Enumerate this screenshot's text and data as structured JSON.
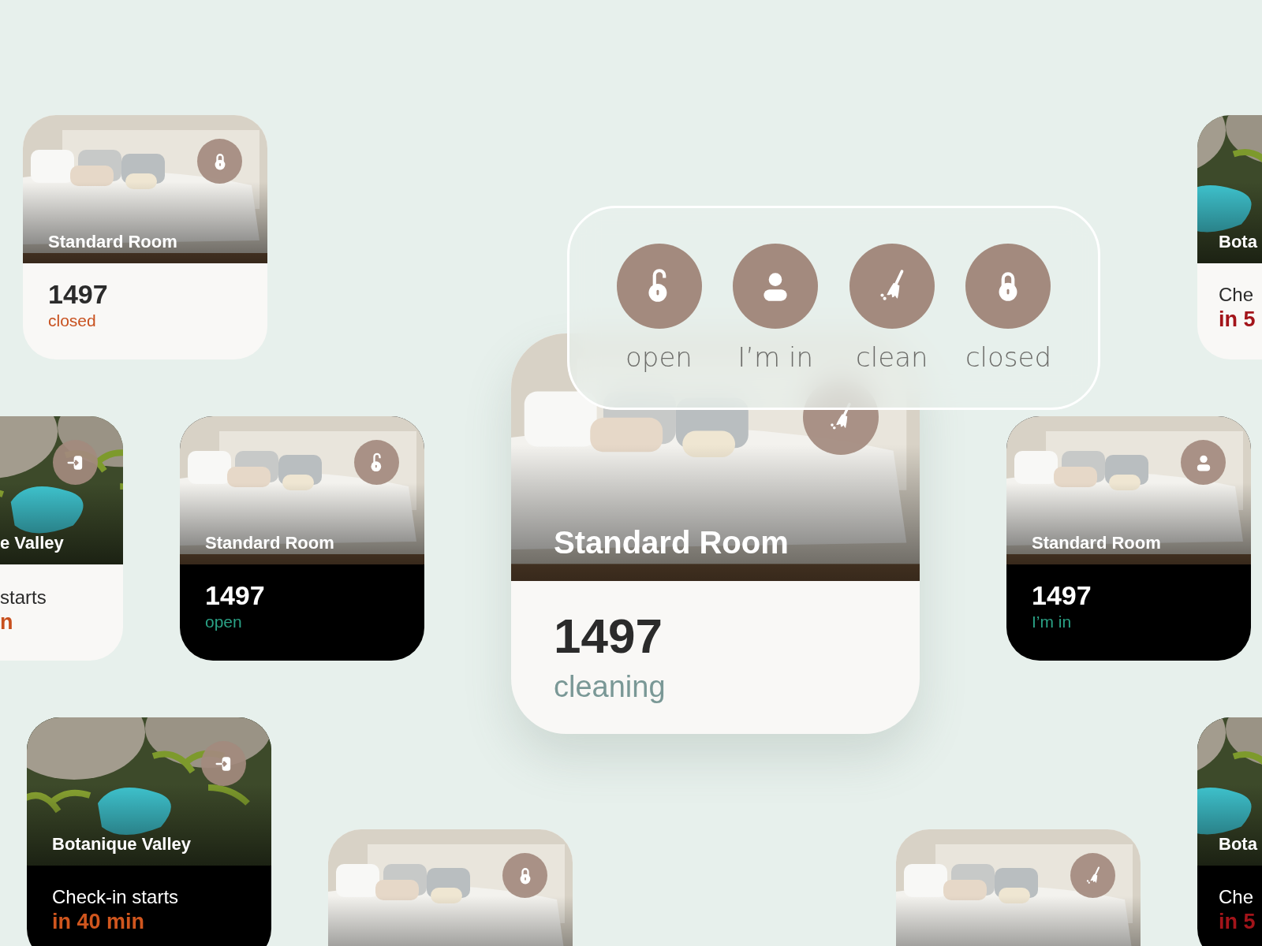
{
  "cards": [
    {
      "kind": "room",
      "title": "Standard Room",
      "line_1": "1497",
      "line_2": "closed",
      "color": "#c8501e"
    },
    {
      "kind": "checkin",
      "title": "e Valley",
      "line_1": "starts",
      "line_2": "n",
      "color": "#c8501e"
    },
    {
      "kind": "room",
      "title": "Standard Room",
      "line_1": "1497",
      "line_2": "open",
      "color": "#2aa185"
    },
    {
      "kind": "room",
      "title": "Standard Room",
      "line_1": "1497",
      "line_2": "cleaning",
      "color": "#7a9896"
    },
    {
      "kind": "room",
      "title": "Standard Room",
      "line_1": "1497",
      "line_2": "I’m in",
      "color": "#2aa185"
    },
    {
      "kind": "checkin",
      "title": "Bota",
      "line_1": "Che",
      "line_2": "in 5",
      "color": "#a3141a"
    },
    {
      "kind": "checkin",
      "title": "Botanique Valley",
      "line_1": "Check-in starts",
      "line_2": "in 40 min",
      "color": "#d0561e"
    },
    {
      "kind": "checkin",
      "title": "Bota",
      "line_1": "Che",
      "line_2": "in 5",
      "color": "#a3141a"
    }
  ],
  "panel": {
    "actions": [
      {
        "label": "open"
      },
      {
        "label": "I’m in"
      },
      {
        "label": "clean"
      },
      {
        "label": "closed"
      }
    ]
  }
}
